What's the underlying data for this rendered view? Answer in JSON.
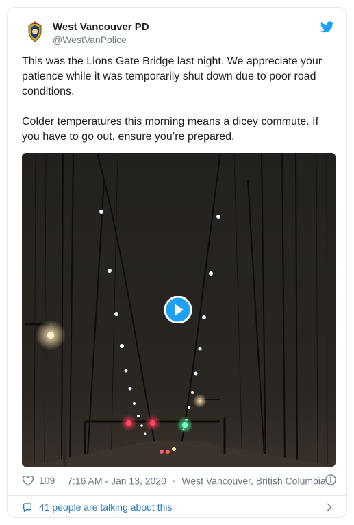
{
  "author": {
    "display_name": "West Vancouver PD",
    "handle": "@WestVanPolice",
    "avatar_icon": "police-badge-icon"
  },
  "brand": {
    "twitter_color": "#1da1f2",
    "link_color": "#2b7bb9",
    "muted_color": "#697882"
  },
  "tweet": {
    "paragraph_1": "This was the Lions Gate Bridge last night. We appreciate your patience while it was temporarily shut down due to poor road conditions.",
    "paragraph_2": "Colder temperatures this morning means a dicey commute. If you have to go out, ensure you’re prepared."
  },
  "media": {
    "type": "video",
    "play_icon": "play-icon"
  },
  "meta": {
    "likes": "109",
    "time": "7:16 AM - Jan 13, 2020",
    "separator": "·",
    "location": "West Vancouver, British Columbia"
  },
  "conversation": {
    "label": "41 people are talking about this"
  }
}
